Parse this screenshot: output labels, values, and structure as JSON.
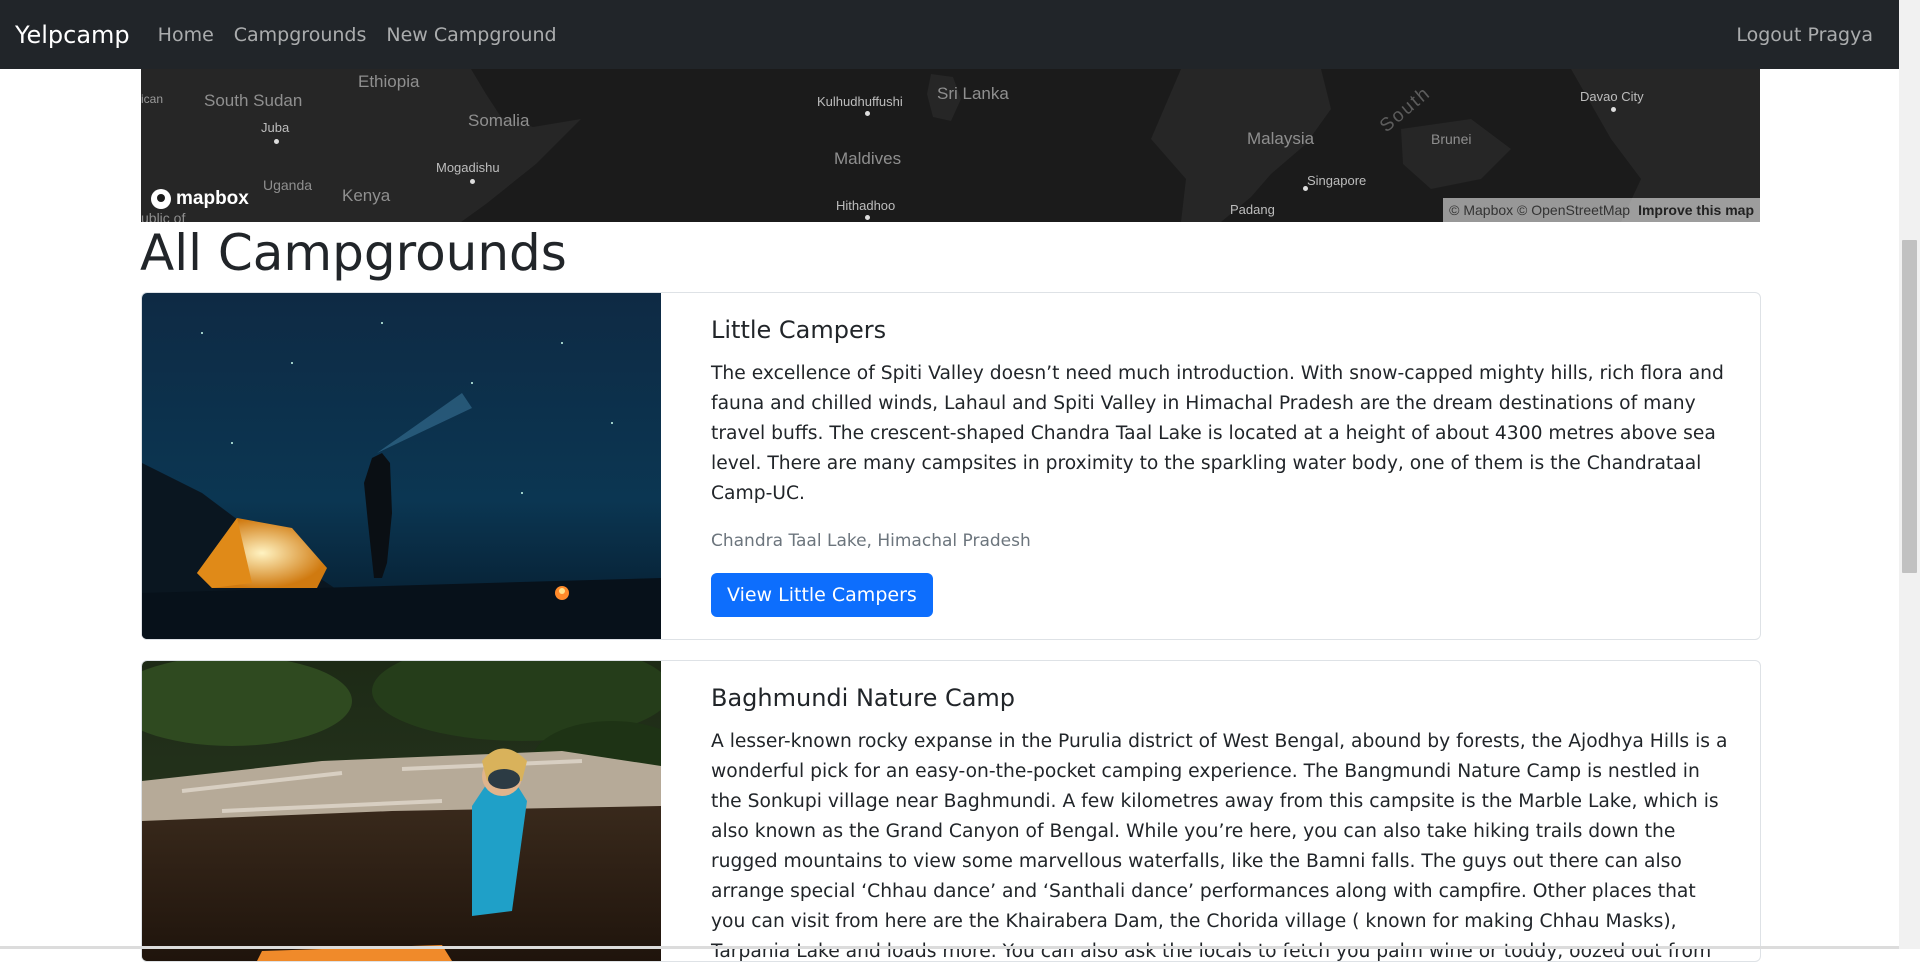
{
  "navbar": {
    "brand": "Yelpcamp",
    "links": [
      "Home",
      "Campgrounds",
      "New Campground"
    ],
    "logout": "Logout Pragya"
  },
  "map": {
    "countries": [
      "South Sudan",
      "Ethiopia",
      "Somalia",
      "Uganda",
      "Kenya",
      "Sri Lanka",
      "Maldives",
      "Malaysia",
      "Brunei"
    ],
    "cities": [
      "Juba",
      "Mogadishu",
      "Kulhudhuffushi",
      "Hithadhoo",
      "Singapore",
      "Padang",
      "Davao City"
    ],
    "sea": "South",
    "edge_left": "ican",
    "edge_bottom": "ublic of",
    "logo_text": "mapbox",
    "attribution": "© Mapbox © OpenStreetMap",
    "improve": "Improve this map"
  },
  "page_title": "All Campgrounds",
  "campgrounds": [
    {
      "title": "Little Campers",
      "description": "The excellence of Spiti Valley doesn’t need much introduction. With snow-capped mighty hills, rich flora and fauna and chilled winds, Lahaul and Spiti Valley in Himachal Pradesh are the dream destinations of many travel buffs. The crescent-shaped Chandra Taal Lake is located at a height of about 4300 metres above sea level. There are many campsites in proximity to the sparkling water body, one of them is the Chandrataal Camp-UC.",
      "location": "Chandra Taal Lake, Himachal Pradesh",
      "button": "View Little Campers"
    },
    {
      "title": "Baghmundi Nature Camp",
      "description": "A lesser-known rocky expanse in the Purulia district of West Bengal, abound by forests, the Ajodhya Hills is a wonderful pick for an easy-on-the-pocket camping experience. The Bangmundi Nature Camp is nestled in the Sonkupi village near Baghmundi. A few kilometres away from this campsite is the Marble Lake, which is also known as the Grand Canyon of Bengal. While you’re here, you can also take hiking trails down the rugged mountains to view some marvellous waterfalls, like the Bamni falls. The guys out there can also arrange special ‘Chhau dance’ and ‘Santhali dance’ performances along with campfire. Other places that you can visit from here are the Khairabera Dam, the Chorida village ( known for making Chhau Masks), Tarpania Lake and loads more. You can also ask the locals to fetch you palm wine or toddy, oozed out from date palm trees in the wee hours of the morning."
    }
  ],
  "colors": {
    "navbar": "#212529",
    "primary_button": "#0d6efd",
    "map_background": "#1b1b1b"
  }
}
